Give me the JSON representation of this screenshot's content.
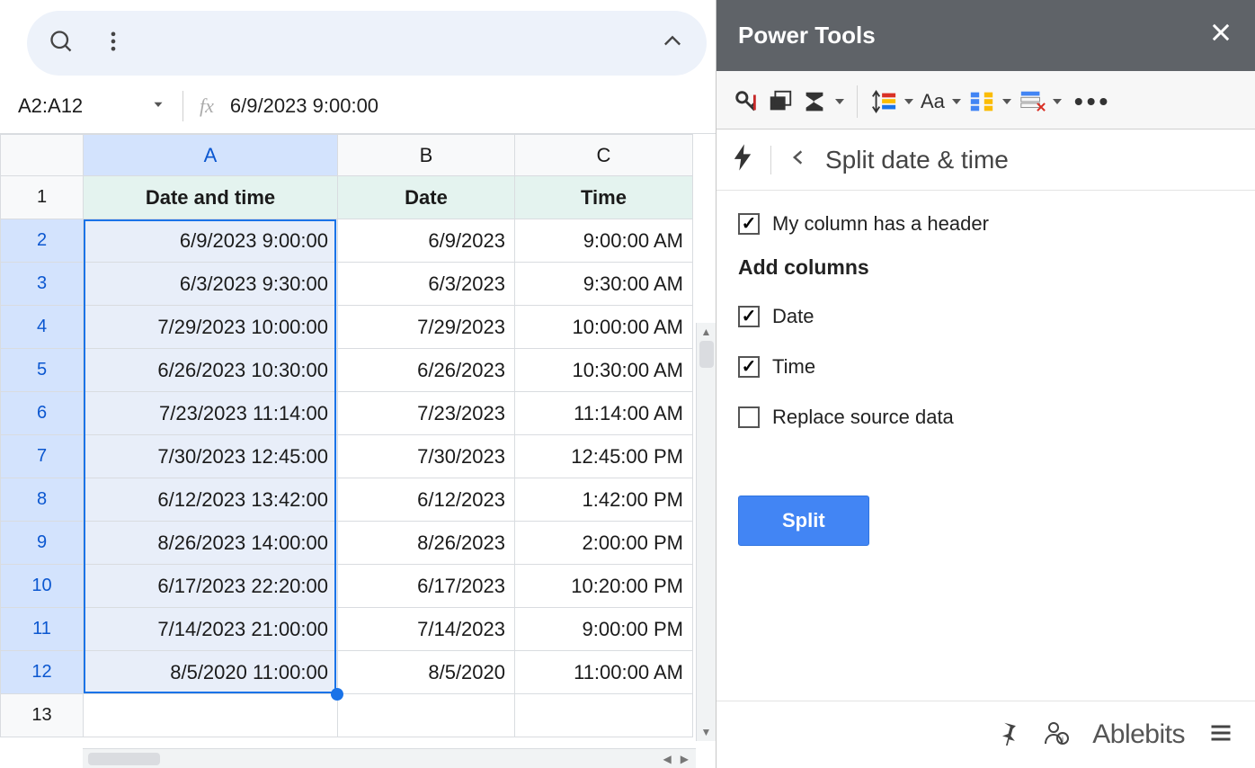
{
  "sheet": {
    "namebox": "A2:A12",
    "formula": "6/9/2023 9:00:00",
    "columns": [
      "A",
      "B",
      "C"
    ],
    "headerRow": {
      "a": "Date and time",
      "b": "Date",
      "c": "Time"
    },
    "rows": [
      {
        "n": "2",
        "a": "6/9/2023 9:00:00",
        "b": "6/9/2023",
        "c": "9:00:00 AM"
      },
      {
        "n": "3",
        "a": "6/3/2023 9:30:00",
        "b": "6/3/2023",
        "c": "9:30:00 AM"
      },
      {
        "n": "4",
        "a": "7/29/2023 10:00:00",
        "b": "7/29/2023",
        "c": "10:00:00 AM"
      },
      {
        "n": "5",
        "a": "6/26/2023 10:30:00",
        "b": "6/26/2023",
        "c": "10:30:00 AM"
      },
      {
        "n": "6",
        "a": "7/23/2023 11:14:00",
        "b": "7/23/2023",
        "c": "11:14:00 AM"
      },
      {
        "n": "7",
        "a": "7/30/2023 12:45:00",
        "b": "7/30/2023",
        "c": "12:45:00 PM"
      },
      {
        "n": "8",
        "a": "6/12/2023 13:42:00",
        "b": "6/12/2023",
        "c": "1:42:00 PM"
      },
      {
        "n": "9",
        "a": "8/26/2023 14:00:00",
        "b": "8/26/2023",
        "c": "2:00:00 PM"
      },
      {
        "n": "10",
        "a": "6/17/2023 22:20:00",
        "b": "6/17/2023",
        "c": "10:20:00 PM"
      },
      {
        "n": "11",
        "a": "7/14/2023 21:00:00",
        "b": "7/14/2023",
        "c": "9:00:00 PM"
      },
      {
        "n": "12",
        "a": "8/5/2020 11:00:00",
        "b": "8/5/2020",
        "c": "11:00:00 AM"
      }
    ],
    "emptyRow": "13"
  },
  "panel": {
    "title": "Power Tools",
    "page_title": "Split date & time",
    "cb_header": "My column has a header",
    "section": "Add columns",
    "cb_date": "Date",
    "cb_time": "Time",
    "cb_replace": "Replace source data",
    "split_btn": "Split",
    "brand": "Ablebits"
  }
}
